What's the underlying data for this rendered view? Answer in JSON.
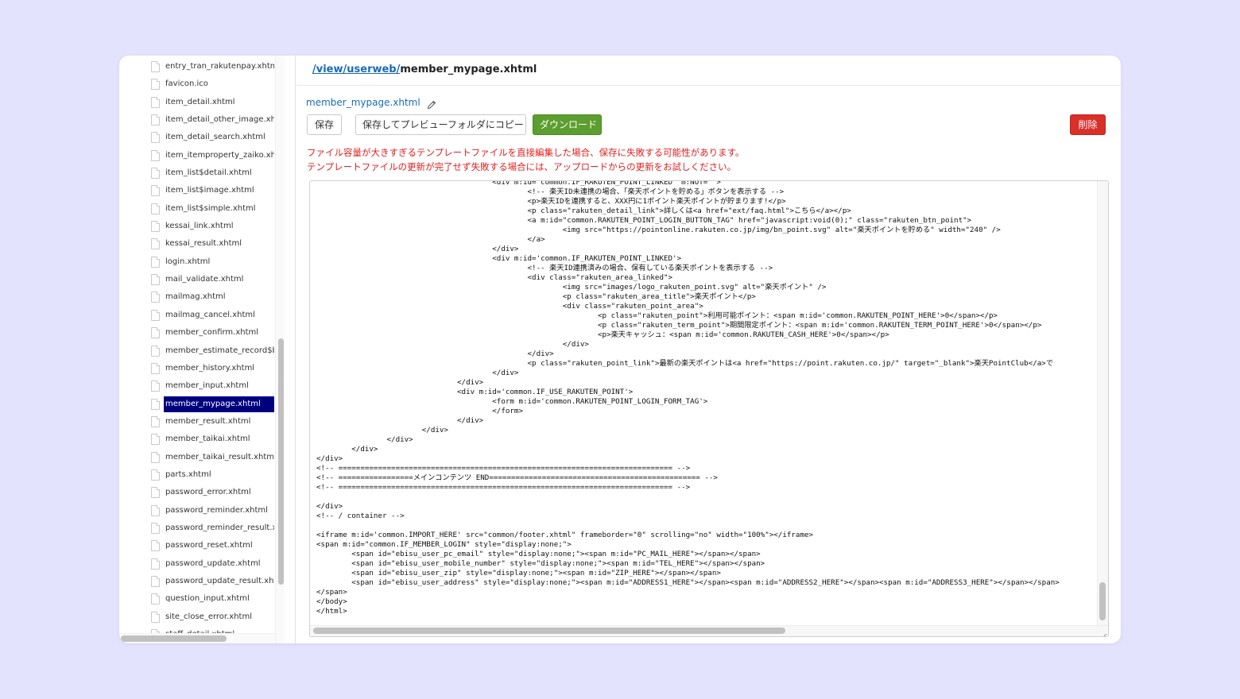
{
  "sidebar": {
    "files": [
      "entry_tran_rakutenpay.xhtml",
      "favicon.ico",
      "item_detail.xhtml",
      "item_detail_other_image.xhtml",
      "item_detail_search.xhtml",
      "item_itemproperty_zaiko.xhtml",
      "item_list$detail.xhtml",
      "item_list$image.xhtml",
      "item_list$simple.xhtml",
      "kessai_link.xhtml",
      "kessai_result.xhtml",
      "login.xhtml",
      "mail_validate.xhtml",
      "mailmag.xhtml",
      "mailmag_cancel.xhtml",
      "member_confirm.xhtml",
      "member_estimate_record$bt",
      "member_history.xhtml",
      "member_input.xhtml",
      "member_mypage.xhtml",
      "member_result.xhtml",
      "member_taikai.xhtml",
      "member_taikai_result.xhtml",
      "parts.xhtml",
      "password_error.xhtml",
      "password_reminder.xhtml",
      "password_reminder_result.xhtml",
      "password_reset.xhtml",
      "password_update.xhtml",
      "password_update_result.xhtml",
      "question_input.xhtml",
      "site_close_error.xhtml",
      "staff_detail.xhtml"
    ],
    "selected_index": 19
  },
  "header": {
    "breadcrumb_link": "/view/userweb/",
    "breadcrumb_current": "member_mypage.xhtml"
  },
  "toolbar": {
    "filename": "member_mypage.xhtml",
    "save_label": "保存",
    "save_copy_label": "保存してプレビューフォルダにコピー",
    "download_label": "ダウンロード",
    "delete_label": "削除"
  },
  "warnings": {
    "line1": "ファイル容量が大きすぎるテンプレートファイルを直接編集した場合、保存に失敗する可能性があります。",
    "line2": "テンプレートファイルの更新が完了せず失敗する場合には、アップロードからの更新をお試しください。"
  },
  "colors": {
    "background": "#e4e3fd",
    "link": "#1a6bb8",
    "selected": "#00007f",
    "download": "#5c9e2f",
    "delete": "#d9302a",
    "warning": "#e02020"
  },
  "code_lines": [
    "                                        <div m:id='common.IF_RAKUTEN_POINT_LINKED' m:NOT=\"\">",
    "                                                <!-- 楽天ID未連携の場合、「楽天ポイントを貯める」ボタンを表示する -->",
    "                                                <p>楽天IDを連携すると、XXX円に1ポイント楽天ポイントが貯まります!</p>",
    "                                                <p class=\"rakuten_detail_link\">詳しくは<a href=\"ext/faq.html\">こちら</a></p>",
    "                                                <a m:id=\"common.RAKUTEN_POINT_LOGIN_BUTTON_TAG\" href=\"javascript:void(0);\" class=\"rakuten_btn_point\">",
    "                                                        <img src=\"https://pointonline.rakuten.co.jp/img/bn_point.svg\" alt=\"楽天ポイントを貯める\" width=\"240\" />",
    "                                                </a>",
    "                                        </div>",
    "                                        <div m:id='common.IF_RAKUTEN_POINT_LINKED'>",
    "                                                <!-- 楽天ID連携済みの場合、保有している楽天ポイントを表示する -->",
    "                                                <div class=\"rakuten_area_linked\">",
    "                                                        <img src=\"images/logo_rakuten_point.svg\" alt=\"楽天ポイント\" />",
    "                                                        <p class=\"rakuten_area_title\">楽天ポイント</p>",
    "                                                        <div class=\"rakuten_point_area\">",
    "                                                                <p class=\"rakuten_point\">利用可能ポイント：<span m:id='common.RAKUTEN_POINT_HERE'>0</span></p>",
    "                                                                <p class=\"rakuten_term_point\">期間限定ポイント：<span m:id='common.RAKUTEN_TERM_POINT_HERE'>0</span></p>",
    "                                                                <p>楽天キャッシュ：<span m:id='common.RAKUTEN_CASH_HERE'>0</span></p>",
    "                                                        </div>",
    "                                                </div>",
    "                                                <p class=\"rakuten_point_link\">最新の楽天ポイントは<a href=\"https://point.rakuten.co.jp/\" target=\"_blank\">楽天PointClub</a>で",
    "                                        </div>",
    "                                </div>",
    "                                <div m:id='common.IF_USE_RAKUTEN_POINT'>",
    "                                        <form m:id='common.RAKUTEN_POINT_LOGIN_FORM_TAG'>",
    "                                        </form>",
    "                                </div>",
    "                        </div>",
    "                </div>",
    "        </div>",
    "</div>",
    "<!-- ============================================================================ -->",
    "<!-- =================メインコンテンツ END================================================ -->",
    "<!-- ============================================================================ -->",
    "",
    "</div>",
    "<!-- / container -->",
    "",
    "<iframe m:id='common.IMPORT_HERE' src=\"common/footer.xhtml\" frameborder=\"0\" scrolling=\"no\" width=\"100%\"></iframe>",
    "<span m:id=\"common.IF_MEMBER_LOGIN\" style=\"display:none;\">",
    "        <span id=\"ebisu_user_pc_email\" style=\"display:none;\"><span m:id=\"PC_MAIL_HERE\"></span></span>",
    "        <span id=\"ebisu_user_mobile_number\" style=\"display:none;\"><span m:id=\"TEL_HERE\"></span></span>",
    "        <span id=\"ebisu_user_zip\" style=\"display:none;\"><span m:id=\"ZIP_HERE\"></span></span>",
    "        <span id=\"ebisu_user_address\" style=\"display:none;\"><span m:id=\"ADDRESS1_HERE\"></span><span m:id=\"ADDRESS2_HERE\"></span><span m:id=\"ADDRESS3_HERE\"></span></span>",
    "</span>",
    "</body>",
    "</html>"
  ]
}
